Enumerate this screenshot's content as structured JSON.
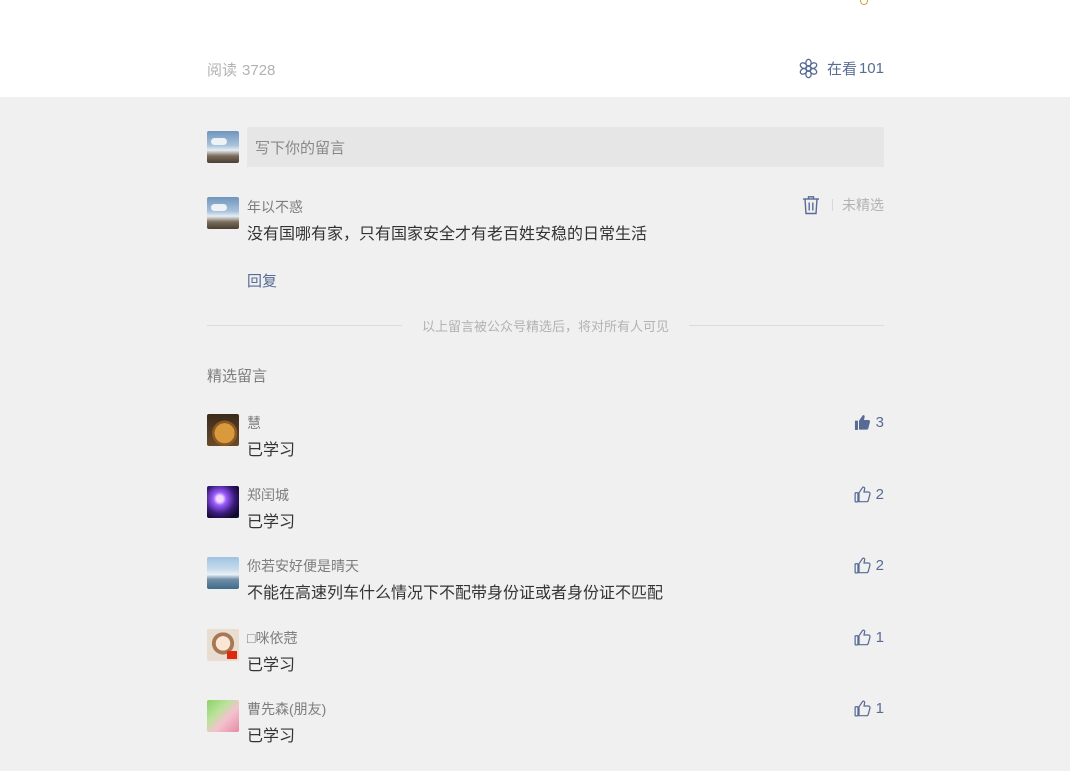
{
  "header": {
    "read_label": "阅读",
    "read_count": "3728",
    "watching_label": "在看",
    "watching_count": "101"
  },
  "compose": {
    "placeholder": "写下你的留言"
  },
  "my_comment": {
    "nickname": "年以不惑",
    "text": "没有国哪有家，只有国家安全才有老百姓安稳的日常生活",
    "status": "未精选",
    "reply_label": "回复"
  },
  "divider_text": "以上留言被公众号精选后，将对所有人可见",
  "featured": {
    "title": "精选留言",
    "comments": [
      {
        "nickname": "慧",
        "text": "已学习",
        "likes": "3",
        "liked": true,
        "avatar": "dog-avatar"
      },
      {
        "nickname": "郑闰城",
        "text": "已学习",
        "likes": "2",
        "liked": false,
        "avatar": "purple-avatar"
      },
      {
        "nickname": "你若安好便是晴天",
        "text": "不能在高速列车什么情况下不配带身份证或者身份证不匹配",
        "likes": "2",
        "liked": false,
        "avatar": "lake-avatar"
      },
      {
        "nickname": "□咪依蒄",
        "text": "已学习",
        "likes": "1",
        "liked": false,
        "avatar": "anime-avatar"
      },
      {
        "nickname": "曹先森(朋友)",
        "text": "已学习",
        "likes": "1",
        "liked": false,
        "avatar": "kid-avatar"
      }
    ]
  },
  "colors": {
    "link": "#576b95",
    "muted": "#b2b2b2",
    "page_bg": "#f0f0f0",
    "input_bg": "#e6e6e6"
  }
}
